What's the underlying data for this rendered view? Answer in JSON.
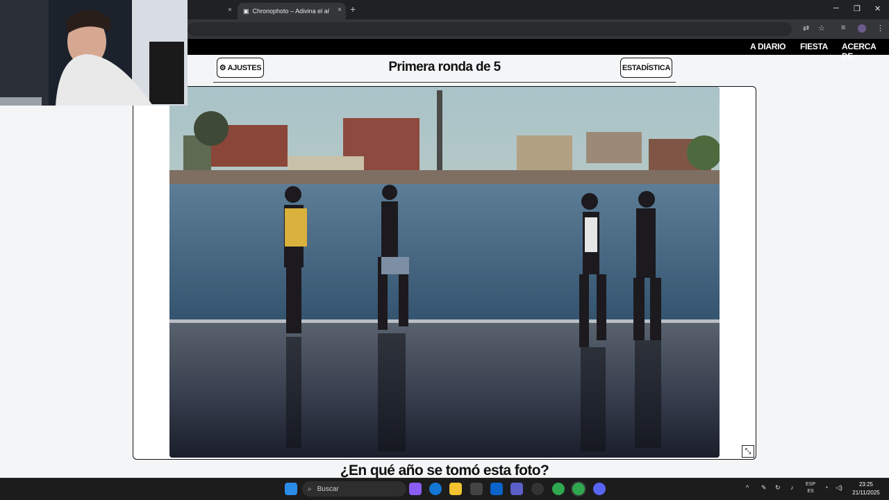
{
  "browser": {
    "active_tab_title": "Chronophoto – Adivina el año",
    "new_tab_symbol": "+",
    "close_symbol": "×"
  },
  "site_nav": {
    "items": [
      "A DIARIO",
      "FIESTA",
      "ACERCA DE"
    ]
  },
  "game": {
    "settings_label": "⚙ AJUSTES",
    "stats_label": "ESTADÍSTICA",
    "round_title": "Primera ronda de 5",
    "question": "¿En qué año se tomó esta foto?"
  },
  "taskbar": {
    "search_placeholder": "Buscar",
    "lang_top": "ESP",
    "lang_bottom": "ES",
    "time": "23:25",
    "date": "21/11/2025"
  },
  "icons": [
    "camera-icon",
    "translate-icon",
    "star-icon",
    "media-icon",
    "profile-icon",
    "kebab-icon",
    "collapse-icon",
    "windows-icon",
    "search-icon",
    "chevron-up-icon",
    "wifi-icon",
    "volume-icon"
  ],
  "colors": {
    "nav_bg": "#000000",
    "page_bg": "#f3f5f7",
    "chrome_dark": "#202124"
  }
}
